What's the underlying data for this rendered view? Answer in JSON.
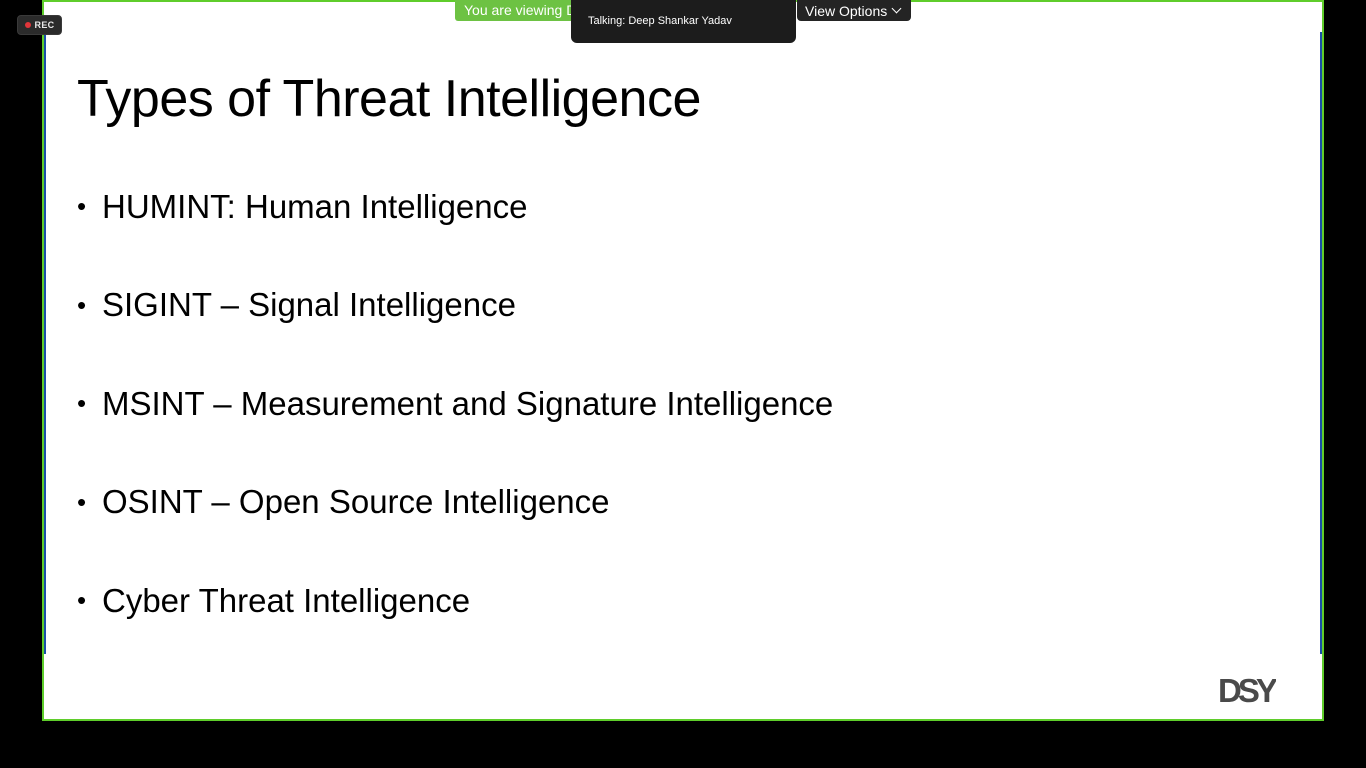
{
  "recording": {
    "label": "REC"
  },
  "share_bar": {
    "viewing_text": "You are viewing D",
    "view_options_label": "View Options",
    "talking_text": "Talking: Deep Shankar Yadav"
  },
  "slide": {
    "title": "Types of Threat Intelligence",
    "bullets": [
      "HUMINT: Human Intelligence",
      "SIGINT – Signal Intelligence",
      "MSINT – Measurement and Signature Intelligence",
      "OSINT – Open Source Intelligence",
      "Cyber Threat Intelligence"
    ],
    "logo_text": "DSY"
  },
  "colors": {
    "share_border": "#5fcd2b",
    "banner_green": "#6dc243",
    "toolbar_dark": "#242424",
    "rec_red": "#e0353a"
  },
  "icons": {
    "view_options_chevron": "chevron-down-icon",
    "rec_indicator": "record-dot-icon",
    "logo": "dsy-logo-icon"
  }
}
